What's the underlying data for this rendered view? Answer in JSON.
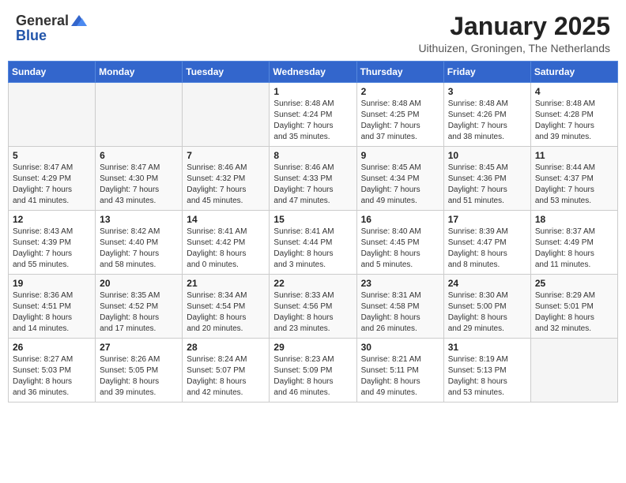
{
  "header": {
    "logo_general": "General",
    "logo_blue": "Blue",
    "month": "January 2025",
    "location": "Uithuizen, Groningen, The Netherlands"
  },
  "weekdays": [
    "Sunday",
    "Monday",
    "Tuesday",
    "Wednesday",
    "Thursday",
    "Friday",
    "Saturday"
  ],
  "weeks": [
    [
      {
        "day": "",
        "empty": true
      },
      {
        "day": "",
        "empty": true
      },
      {
        "day": "",
        "empty": true
      },
      {
        "day": "1",
        "sunrise": "8:48 AM",
        "sunset": "4:24 PM",
        "daylight": "7 hours and 35 minutes."
      },
      {
        "day": "2",
        "sunrise": "8:48 AM",
        "sunset": "4:25 PM",
        "daylight": "7 hours and 37 minutes."
      },
      {
        "day": "3",
        "sunrise": "8:48 AM",
        "sunset": "4:26 PM",
        "daylight": "7 hours and 38 minutes."
      },
      {
        "day": "4",
        "sunrise": "8:48 AM",
        "sunset": "4:28 PM",
        "daylight": "7 hours and 39 minutes."
      }
    ],
    [
      {
        "day": "5",
        "sunrise": "8:47 AM",
        "sunset": "4:29 PM",
        "daylight": "7 hours and 41 minutes."
      },
      {
        "day": "6",
        "sunrise": "8:47 AM",
        "sunset": "4:30 PM",
        "daylight": "7 hours and 43 minutes."
      },
      {
        "day": "7",
        "sunrise": "8:46 AM",
        "sunset": "4:32 PM",
        "daylight": "7 hours and 45 minutes."
      },
      {
        "day": "8",
        "sunrise": "8:46 AM",
        "sunset": "4:33 PM",
        "daylight": "7 hours and 47 minutes."
      },
      {
        "day": "9",
        "sunrise": "8:45 AM",
        "sunset": "4:34 PM",
        "daylight": "7 hours and 49 minutes."
      },
      {
        "day": "10",
        "sunrise": "8:45 AM",
        "sunset": "4:36 PM",
        "daylight": "7 hours and 51 minutes."
      },
      {
        "day": "11",
        "sunrise": "8:44 AM",
        "sunset": "4:37 PM",
        "daylight": "7 hours and 53 minutes."
      }
    ],
    [
      {
        "day": "12",
        "sunrise": "8:43 AM",
        "sunset": "4:39 PM",
        "daylight": "7 hours and 55 minutes."
      },
      {
        "day": "13",
        "sunrise": "8:42 AM",
        "sunset": "4:40 PM",
        "daylight": "7 hours and 58 minutes."
      },
      {
        "day": "14",
        "sunrise": "8:41 AM",
        "sunset": "4:42 PM",
        "daylight": "8 hours and 0 minutes."
      },
      {
        "day": "15",
        "sunrise": "8:41 AM",
        "sunset": "4:44 PM",
        "daylight": "8 hours and 3 minutes."
      },
      {
        "day": "16",
        "sunrise": "8:40 AM",
        "sunset": "4:45 PM",
        "daylight": "8 hours and 5 minutes."
      },
      {
        "day": "17",
        "sunrise": "8:39 AM",
        "sunset": "4:47 PM",
        "daylight": "8 hours and 8 minutes."
      },
      {
        "day": "18",
        "sunrise": "8:37 AM",
        "sunset": "4:49 PM",
        "daylight": "8 hours and 11 minutes."
      }
    ],
    [
      {
        "day": "19",
        "sunrise": "8:36 AM",
        "sunset": "4:51 PM",
        "daylight": "8 hours and 14 minutes."
      },
      {
        "day": "20",
        "sunrise": "8:35 AM",
        "sunset": "4:52 PM",
        "daylight": "8 hours and 17 minutes."
      },
      {
        "day": "21",
        "sunrise": "8:34 AM",
        "sunset": "4:54 PM",
        "daylight": "8 hours and 20 minutes."
      },
      {
        "day": "22",
        "sunrise": "8:33 AM",
        "sunset": "4:56 PM",
        "daylight": "8 hours and 23 minutes."
      },
      {
        "day": "23",
        "sunrise": "8:31 AM",
        "sunset": "4:58 PM",
        "daylight": "8 hours and 26 minutes."
      },
      {
        "day": "24",
        "sunrise": "8:30 AM",
        "sunset": "5:00 PM",
        "daylight": "8 hours and 29 minutes."
      },
      {
        "day": "25",
        "sunrise": "8:29 AM",
        "sunset": "5:01 PM",
        "daylight": "8 hours and 32 minutes."
      }
    ],
    [
      {
        "day": "26",
        "sunrise": "8:27 AM",
        "sunset": "5:03 PM",
        "daylight": "8 hours and 36 minutes."
      },
      {
        "day": "27",
        "sunrise": "8:26 AM",
        "sunset": "5:05 PM",
        "daylight": "8 hours and 39 minutes."
      },
      {
        "day": "28",
        "sunrise": "8:24 AM",
        "sunset": "5:07 PM",
        "daylight": "8 hours and 42 minutes."
      },
      {
        "day": "29",
        "sunrise": "8:23 AM",
        "sunset": "5:09 PM",
        "daylight": "8 hours and 46 minutes."
      },
      {
        "day": "30",
        "sunrise": "8:21 AM",
        "sunset": "5:11 PM",
        "daylight": "8 hours and 49 minutes."
      },
      {
        "day": "31",
        "sunrise": "8:19 AM",
        "sunset": "5:13 PM",
        "daylight": "8 hours and 53 minutes."
      },
      {
        "day": "",
        "empty": true
      }
    ]
  ]
}
